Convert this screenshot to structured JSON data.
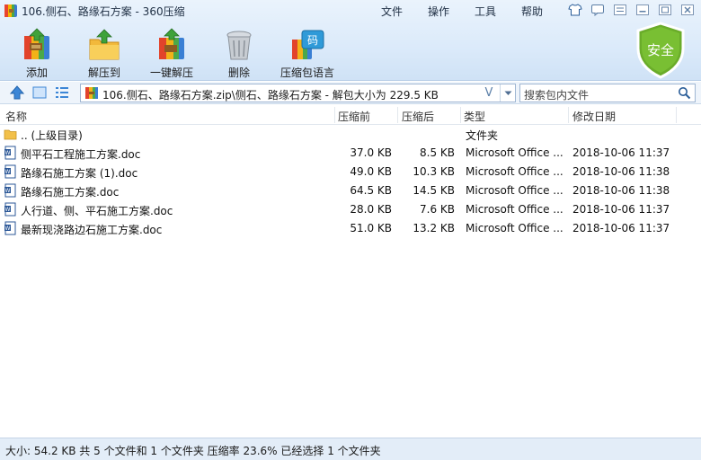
{
  "window": {
    "title": "106.侧石、路缘石方案 - 360压缩"
  },
  "menu": [
    {
      "label": "文件"
    },
    {
      "label": "操作"
    },
    {
      "label": "工具"
    },
    {
      "label": "帮助"
    }
  ],
  "toolbar": [
    {
      "label": "添加",
      "icon": "add-archive-icon"
    },
    {
      "label": "解压到",
      "icon": "extract-to-icon"
    },
    {
      "label": "一键解压",
      "icon": "one-click-extract-icon"
    },
    {
      "label": "删除",
      "icon": "delete-icon"
    },
    {
      "label": "压缩包语言",
      "icon": "archive-language-icon"
    }
  ],
  "security_badge": {
    "label": "安全",
    "color": "#6aac2a"
  },
  "address": {
    "path": "106.侧石、路缘石方案.zip\\侧石、路缘石方案 - 解包大小为 229.5 KB",
    "v_label": "V"
  },
  "search": {
    "placeholder": "搜索包内文件"
  },
  "columns": {
    "name": "名称",
    "packed": "压缩前",
    "compressed": "压缩后",
    "type": "类型",
    "modified": "修改日期"
  },
  "parent_row": {
    "name": ".. (上级目录)",
    "type": "文件夹"
  },
  "files": [
    {
      "name": "侧平石工程施工方案.doc",
      "packed": "37.0 KB",
      "compressed": "8.5 KB",
      "type": "Microsoft Office ...",
      "modified": "2018-10-06 11:37"
    },
    {
      "name": "路缘石施工方案 (1).doc",
      "packed": "49.0 KB",
      "compressed": "10.3 KB",
      "type": "Microsoft Office ...",
      "modified": "2018-10-06 11:38"
    },
    {
      "name": "路缘石施工方案.doc",
      "packed": "64.5 KB",
      "compressed": "14.5 KB",
      "type": "Microsoft Office ...",
      "modified": "2018-10-06 11:38"
    },
    {
      "name": "人行道、侧、平石施工方案.doc",
      "packed": "28.0 KB",
      "compressed": "7.6 KB",
      "type": "Microsoft Office ...",
      "modified": "2018-10-06 11:37"
    },
    {
      "name": "最新现浇路边石施工方案.doc",
      "packed": "51.0 KB",
      "compressed": "13.2 KB",
      "type": "Microsoft Office ...",
      "modified": "2018-10-06 11:37"
    }
  ],
  "status": {
    "text": "大小: 54.2 KB 共 5 个文件和 1 个文件夹 压缩率 23.6% 已经选择 1 个文件夹"
  },
  "colors": {
    "accent": "#1e6fc5",
    "toolbar_bg": "#dbeafa",
    "status_bg": "#e3edf8"
  }
}
